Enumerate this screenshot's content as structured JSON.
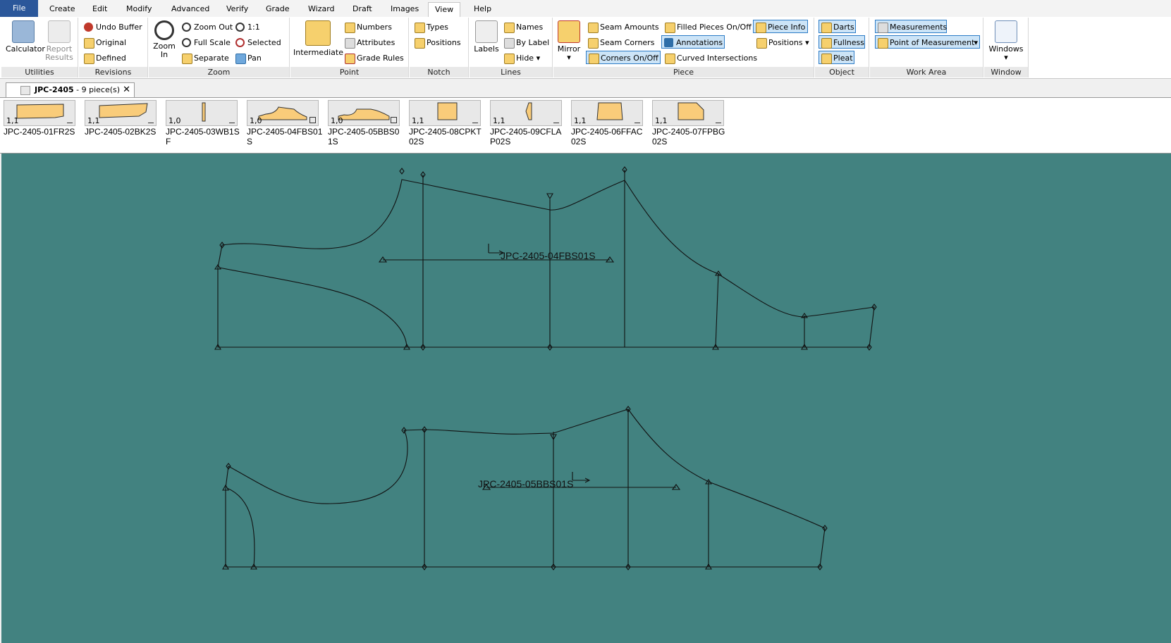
{
  "menu": {
    "file": "File",
    "tabs": [
      "Create",
      "Edit",
      "Modify",
      "Advanced",
      "Verify",
      "Grade",
      "Wizard",
      "Draft",
      "Images",
      "View",
      "Help"
    ],
    "active": "View"
  },
  "ribbon": {
    "utilities": {
      "label": "Utilities",
      "calculator": "Calculator",
      "report_results_1": "Report",
      "report_results_2": "Results"
    },
    "revisions": {
      "label": "Revisions",
      "undo_buffer": "Undo Buffer",
      "original": "Original",
      "defined": "Defined"
    },
    "zoom": {
      "label": "Zoom",
      "zoom_in_1": "Zoom",
      "zoom_in_2": "In",
      "zoom_out": "Zoom Out",
      "one_to_one": "1:1",
      "full_scale": "Full Scale",
      "selected": "Selected",
      "separate": "Separate",
      "pan": "Pan"
    },
    "point": {
      "label": "Point",
      "intermediate": "Intermediate",
      "numbers": "Numbers",
      "attributes": "Attributes",
      "grade_rules": "Grade Rules"
    },
    "notch": {
      "label": "Notch",
      "types": "Types",
      "positions": "Positions"
    },
    "lines": {
      "label": "Lines",
      "labels": "Labels",
      "names": "Names",
      "by_label": "By Label",
      "hide": "Hide"
    },
    "piece": {
      "label": "Piece",
      "mirror": "Mirror",
      "seam_amounts": "Seam Amounts",
      "seam_corners": "Seam Corners",
      "corners_on_off": "Corners On/Off",
      "filled_pieces": "Filled Pieces On/Off",
      "annotations": "Annotations",
      "curved_intersections": "Curved Intersections",
      "piece_info": "Piece Info",
      "positions": "Positions"
    },
    "object": {
      "label": "Object",
      "darts": "Darts",
      "fullness": "Fullness",
      "pleat": "Pleat"
    },
    "work_area": {
      "label": "Work Area",
      "measurements": "Measurements",
      "point_of_measurement": "Point of Measurement"
    },
    "window": {
      "label": "Window",
      "windows": "Windows"
    }
  },
  "document_tab": {
    "name": "JPC-2405",
    "count": " -  9 piece(s)",
    "close": "✕"
  },
  "pieces": [
    {
      "scale": "1,1",
      "name": "JPC-2405-01FR2S"
    },
    {
      "scale": "1,1",
      "name": "JPC-2405-02BK2S"
    },
    {
      "scale": "1,0",
      "name": "JPC-2405-03WB1SF"
    },
    {
      "scale": "1,0",
      "name": "JPC-2405-04FBS01S"
    },
    {
      "scale": "1,0",
      "name": "JPC-2405-05BBS01S"
    },
    {
      "scale": "1,1",
      "name": "JPC-2405-08CPKT02S"
    },
    {
      "scale": "1,1",
      "name": "JPC-2405-09CFLAP02S"
    },
    {
      "scale": "1,1",
      "name": "JPC-2405-06FFAC02S"
    },
    {
      "scale": "1,1",
      "name": "JPC-2405-07FPBG02S"
    }
  ],
  "canvas": {
    "piece_a_label": "JPC-2405-04FBS01S",
    "piece_b_label": "JPC-2405-05BBS01S",
    "background": "#428280"
  }
}
